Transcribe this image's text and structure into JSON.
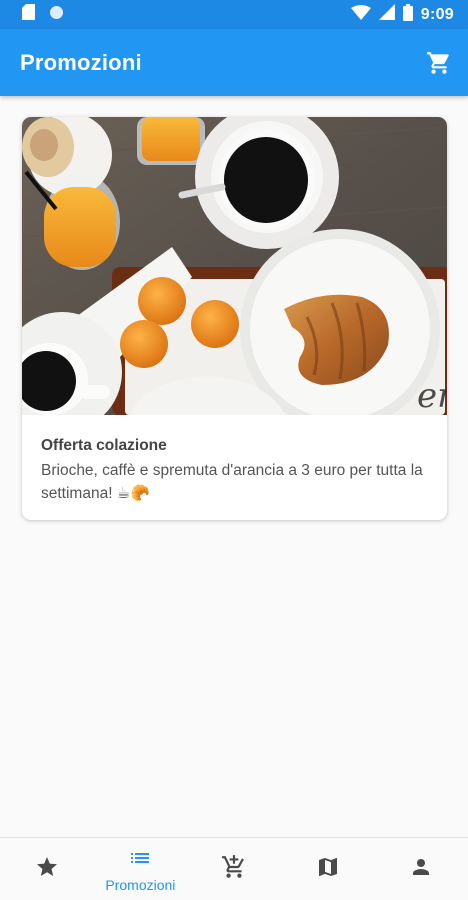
{
  "status_bar": {
    "time": "9:09",
    "icons": [
      "sd-card-icon",
      "circle-notification-icon",
      "wifi-icon",
      "signal-icon",
      "battery-icon"
    ]
  },
  "app_bar": {
    "title": "Promozioni",
    "cart_icon": "cart-icon"
  },
  "promotions": [
    {
      "image": "breakfast-photo",
      "title": "Offerta colazione",
      "description": "Brioche, caffè e spremuta d'arancia a 3 euro per tutta la settimana! ☕🥐"
    }
  ],
  "bottom_nav": {
    "items": [
      {
        "icon": "star-icon",
        "label": "",
        "active": false
      },
      {
        "icon": "list-icon",
        "label": "Promozioni",
        "active": true
      },
      {
        "icon": "add-to-cart-icon",
        "label": "",
        "active": false
      },
      {
        "icon": "map-icon",
        "label": "",
        "active": false
      },
      {
        "icon": "person-icon",
        "label": "",
        "active": false
      }
    ]
  },
  "colors": {
    "primary": "#2196f3",
    "status_bar": "#1e88e5",
    "background": "#fafafa",
    "nav_inactive": "#4a4a4a"
  }
}
